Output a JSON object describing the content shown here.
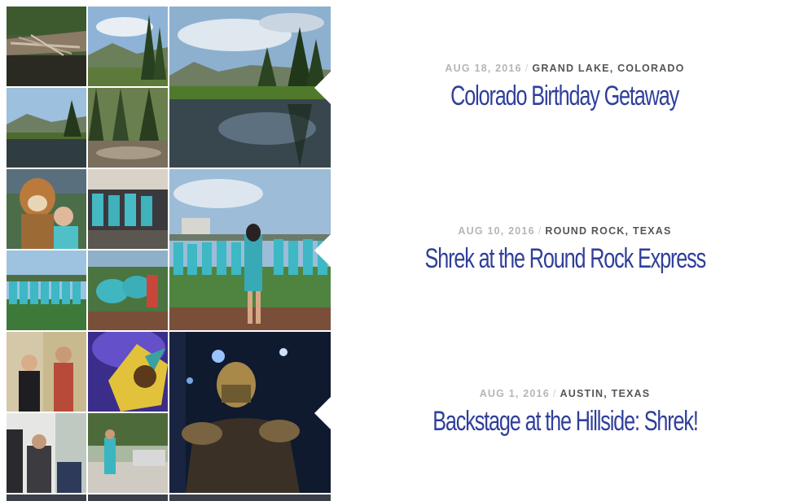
{
  "posts": [
    {
      "date": "AUG 18, 2016",
      "separator": "/",
      "location": "GRAND LAKE, COLORADO",
      "title": "Colorado Birthday Getaway"
    },
    {
      "date": "AUG 10, 2016",
      "separator": "/",
      "location": "ROUND ROCK, TEXAS",
      "title": "Shrek at the Round Rock Express"
    },
    {
      "date": "AUG 1, 2016",
      "separator": "/",
      "location": "AUSTIN, TEXAS",
      "title": "Backstage at the Hillside: Shrek!"
    }
  ],
  "colors": {
    "title": "#2f3f9a",
    "date": "#b5b5b5",
    "location": "#555555",
    "background": "#ffffff"
  }
}
